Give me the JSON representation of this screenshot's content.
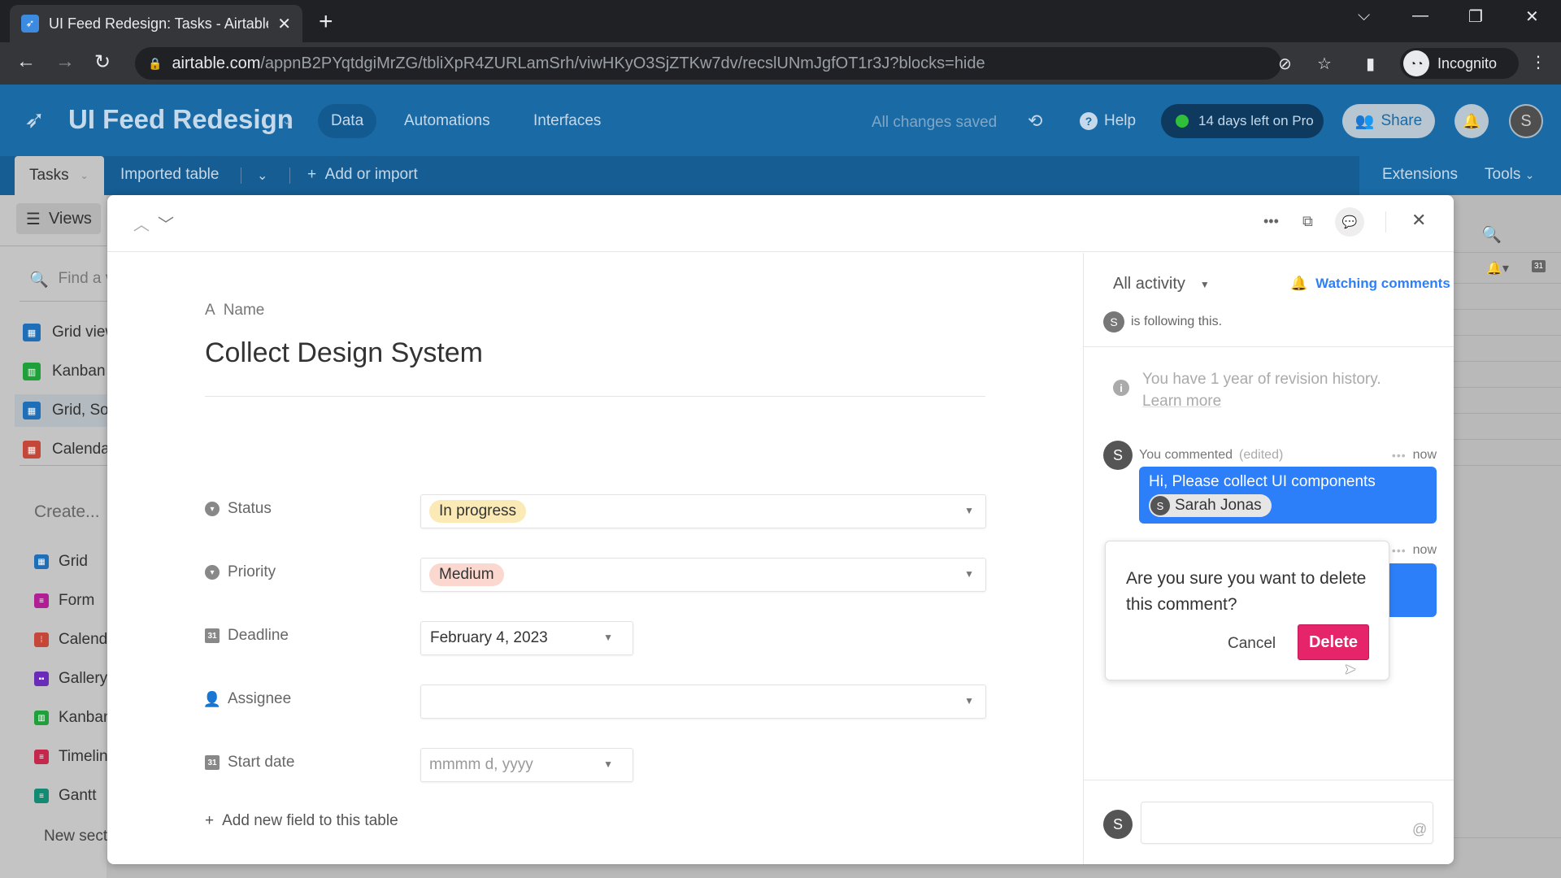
{
  "browser": {
    "tab_title": "UI Feed Redesign: Tasks - Airtable",
    "url_host": "airtable.com",
    "url_path": "/appnB2PYqtdgiMrZG/tbliXpR4ZURLamSrh/viwHKyO3SjZTKw7dv/recslUNmJgfOT1r3J?blocks=hide",
    "profile_label": "Incognito"
  },
  "header": {
    "base_name": "UI Feed Redesign",
    "tabs": [
      {
        "label": "Data",
        "active": true
      },
      {
        "label": "Automations",
        "active": false
      },
      {
        "label": "Interfaces",
        "active": false
      }
    ],
    "save_status": "All changes saved",
    "help_label": "Help",
    "trial_label": "14 days left on Pro",
    "share_label": "Share",
    "user_initial": "S"
  },
  "table_bar": {
    "active_table": "Tasks",
    "other_table": "Imported table",
    "add_label": "Add or import",
    "extensions_label": "Extensions",
    "tools_label": "Tools"
  },
  "sidebar": {
    "views_label": "Views",
    "search_placeholder": "Find a view",
    "views": [
      {
        "label": "Grid view",
        "icon": "grid",
        "color": "#1e6fb8"
      },
      {
        "label": "Kanban",
        "icon": "kanban",
        "color": "#20a03a"
      },
      {
        "label": "Grid, Sorted",
        "icon": "grid",
        "color": "#1e6fb8",
        "selected": true
      },
      {
        "label": "Calendar",
        "icon": "calendar",
        "color": "#c4473a"
      }
    ],
    "create_label": "Create...",
    "create_items": [
      {
        "label": "Grid",
        "icon": "grid",
        "color": "#1e6fb8"
      },
      {
        "label": "Form",
        "icon": "form",
        "color": "#b01f96"
      },
      {
        "label": "Calendar",
        "icon": "calendar",
        "color": "#c4473a"
      },
      {
        "label": "Gallery",
        "icon": "gallery",
        "color": "#6a2cb8"
      },
      {
        "label": "Kanban",
        "icon": "kanban",
        "color": "#20a03a"
      },
      {
        "label": "Timeline",
        "icon": "timeline",
        "color": "#c4284c"
      },
      {
        "label": "Gantt",
        "icon": "gantt",
        "color": "#138a72"
      }
    ],
    "new_section_label": "New section"
  },
  "record": {
    "name_field_label": "Name",
    "title": "Collect Design System",
    "fields": [
      {
        "label": "Status",
        "type": "select",
        "value": "In progress",
        "color": "#fbeab5"
      },
      {
        "label": "Priority",
        "type": "select",
        "value": "Medium",
        "color": "#fbd8cf"
      },
      {
        "label": "Deadline",
        "type": "date",
        "value": "February 4, 2023"
      },
      {
        "label": "Assignee",
        "type": "user",
        "value": ""
      },
      {
        "label": "Start date",
        "type": "date",
        "value": "",
        "placeholder": "mmmm d, yyyy"
      }
    ],
    "add_field_label": "Add new field to this table"
  },
  "activity": {
    "filter_label": "All activity",
    "watching_label": "Watching comments",
    "follower_initial": "S",
    "following_text": "is following this.",
    "revision_text": "You have 1 year of revision history.",
    "learn_more": "Learn more",
    "comments": [
      {
        "author_initial": "S",
        "meta": "You commented",
        "edited": "(edited)",
        "time": "now",
        "text": "Hi, Please collect UI components",
        "mention": {
          "initial": "S",
          "name": "Sarah Jonas"
        }
      },
      {
        "author_initial": "S",
        "time": "now",
        "text": ""
      }
    ],
    "confirm": {
      "message": "Are you sure you want to delete this comment?",
      "cancel_label": "Cancel",
      "delete_label": "Delete"
    },
    "composer": {
      "user_initial": "S",
      "value": "",
      "mention_icon": "@"
    }
  },
  "colors": {
    "brand_blue": "#1a6aa5",
    "comment_blue": "#2d7ff9",
    "delete_pink": "#e5246a",
    "trial_green": "#2fbf3a"
  }
}
